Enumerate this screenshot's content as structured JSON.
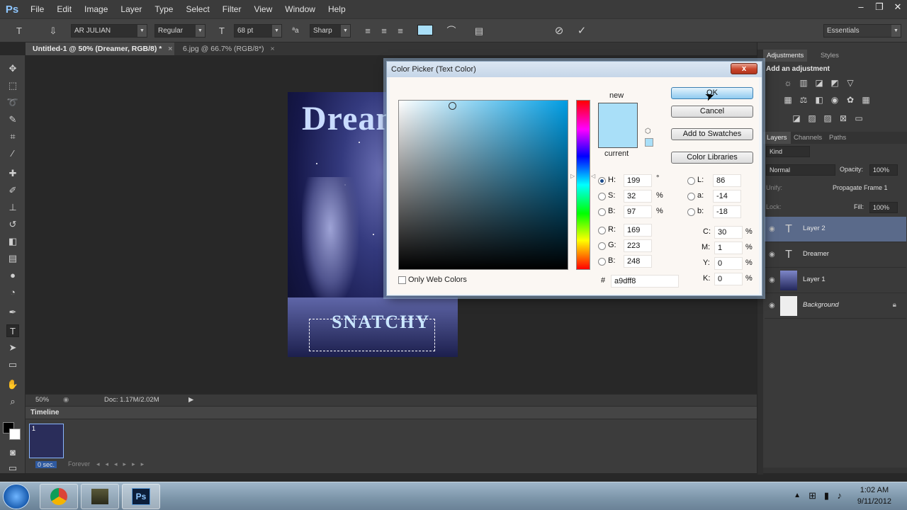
{
  "app": {
    "logo": "Ps"
  },
  "menu": [
    "File",
    "Edit",
    "Image",
    "Layer",
    "Type",
    "Select",
    "Filter",
    "View",
    "Window",
    "Help"
  ],
  "window_controls": [
    "–",
    "❐",
    "✕"
  ],
  "options": {
    "font_family": "AR JULIAN",
    "font_style": "Regular",
    "font_size": "68 pt",
    "aa_label": "ªa",
    "antialias": "Sharp",
    "text_color_hex": "#a9dff8",
    "workspace": "Essentials"
  },
  "doc_tabs": [
    {
      "label": "Untitled-1 @ 50% (Dreamer, RGB/8) *",
      "close": "×"
    },
    {
      "label": "6.jpg @ 66.7% (RGB/8*)",
      "close": "×"
    }
  ],
  "artwork": {
    "title": "Dream",
    "subtitle": "SNATCHY"
  },
  "status": {
    "zoom": "50%",
    "doc": "Doc: 1.17M/2.02M"
  },
  "timeline": {
    "title": "Timeline",
    "frame_num": "1",
    "frame_time": "0 sec.",
    "loop": "Forever"
  },
  "panels": {
    "adjustments_tab": "Adjustments",
    "styles_tab": "Styles",
    "adjustments_heading": "Add an adjustment",
    "layers_tab": "Layers",
    "channels_tab": "Channels",
    "paths_tab": "Paths",
    "kind": "Kind",
    "blend_mode": "Normal",
    "opacity_label": "Opacity:",
    "opacity": "100%",
    "unify_label": "Unify:",
    "propagate": "Propagate Frame 1",
    "lock_label": "Lock:",
    "fill_label": "Fill:",
    "fill": "100%"
  },
  "layers": [
    {
      "name": "Layer 2",
      "type": "text",
      "thumb": "T"
    },
    {
      "name": "Dreamer",
      "type": "text",
      "thumb": "T"
    },
    {
      "name": "Layer 1",
      "type": "image",
      "thumb": ""
    },
    {
      "name": "Background",
      "type": "background",
      "thumb": ""
    }
  ],
  "dialog": {
    "title": "Color Picker (Text Color)",
    "close": "x",
    "new_label": "new",
    "current_label": "current",
    "buttons": {
      "ok": "OK",
      "cancel": "Cancel",
      "add_swatches": "Add to Swatches",
      "libraries": "Color Libraries"
    },
    "only_web": "Only Web Colors",
    "hsb": [
      {
        "label": "H:",
        "value": "199",
        "unit": "°"
      },
      {
        "label": "S:",
        "value": "32",
        "unit": "%"
      },
      {
        "label": "B:",
        "value": "97",
        "unit": "%"
      }
    ],
    "rgb": [
      {
        "label": "R:",
        "value": "169"
      },
      {
        "label": "G:",
        "value": "223"
      },
      {
        "label": "B:",
        "value": "248"
      }
    ],
    "lab": [
      {
        "label": "L:",
        "value": "86"
      },
      {
        "label": "a:",
        "value": "-14"
      },
      {
        "label": "b:",
        "value": "-18"
      }
    ],
    "cmyk": [
      {
        "label": "C:",
        "value": "30",
        "unit": "%"
      },
      {
        "label": "M:",
        "value": "1",
        "unit": "%"
      },
      {
        "label": "Y:",
        "value": "0",
        "unit": "%"
      },
      {
        "label": "K:",
        "value": "0",
        "unit": "%"
      }
    ],
    "hash": "#",
    "hex": "a9dff8",
    "new_color": "#a9dff8",
    "current_color": "#a9dff8"
  },
  "taskbar": {
    "time": "1:02 AM",
    "date": "9/11/2012",
    "ps_label": "Ps"
  }
}
